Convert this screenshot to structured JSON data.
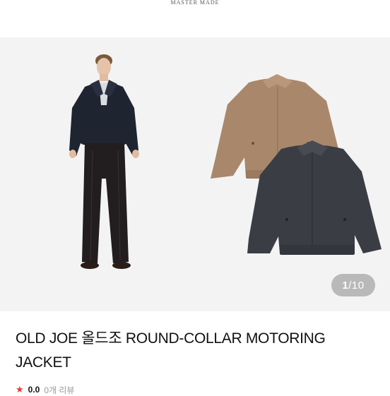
{
  "brand": {
    "name": "MASTER MADE"
  },
  "gallery": {
    "current": "1",
    "separator": "/",
    "total": "10",
    "images": [
      "model-wearing-navy-jacket",
      "brown-jacket-flatlay",
      "charcoal-jacket-flatlay"
    ]
  },
  "product": {
    "title": "OLD JOE 올드조 ROUND-COLLAR MOTORING JACKET"
  },
  "rating": {
    "icon": "star-icon",
    "score": "0.0",
    "reviews": "0개 리뷰"
  },
  "colors": {
    "gallery_bg": "#f3f3f3",
    "counter_bg": "#b9b9b9",
    "jacket_brown": "#a9876b",
    "jacket_charcoal": "#3a3d44",
    "rating_star": "#e53935"
  }
}
